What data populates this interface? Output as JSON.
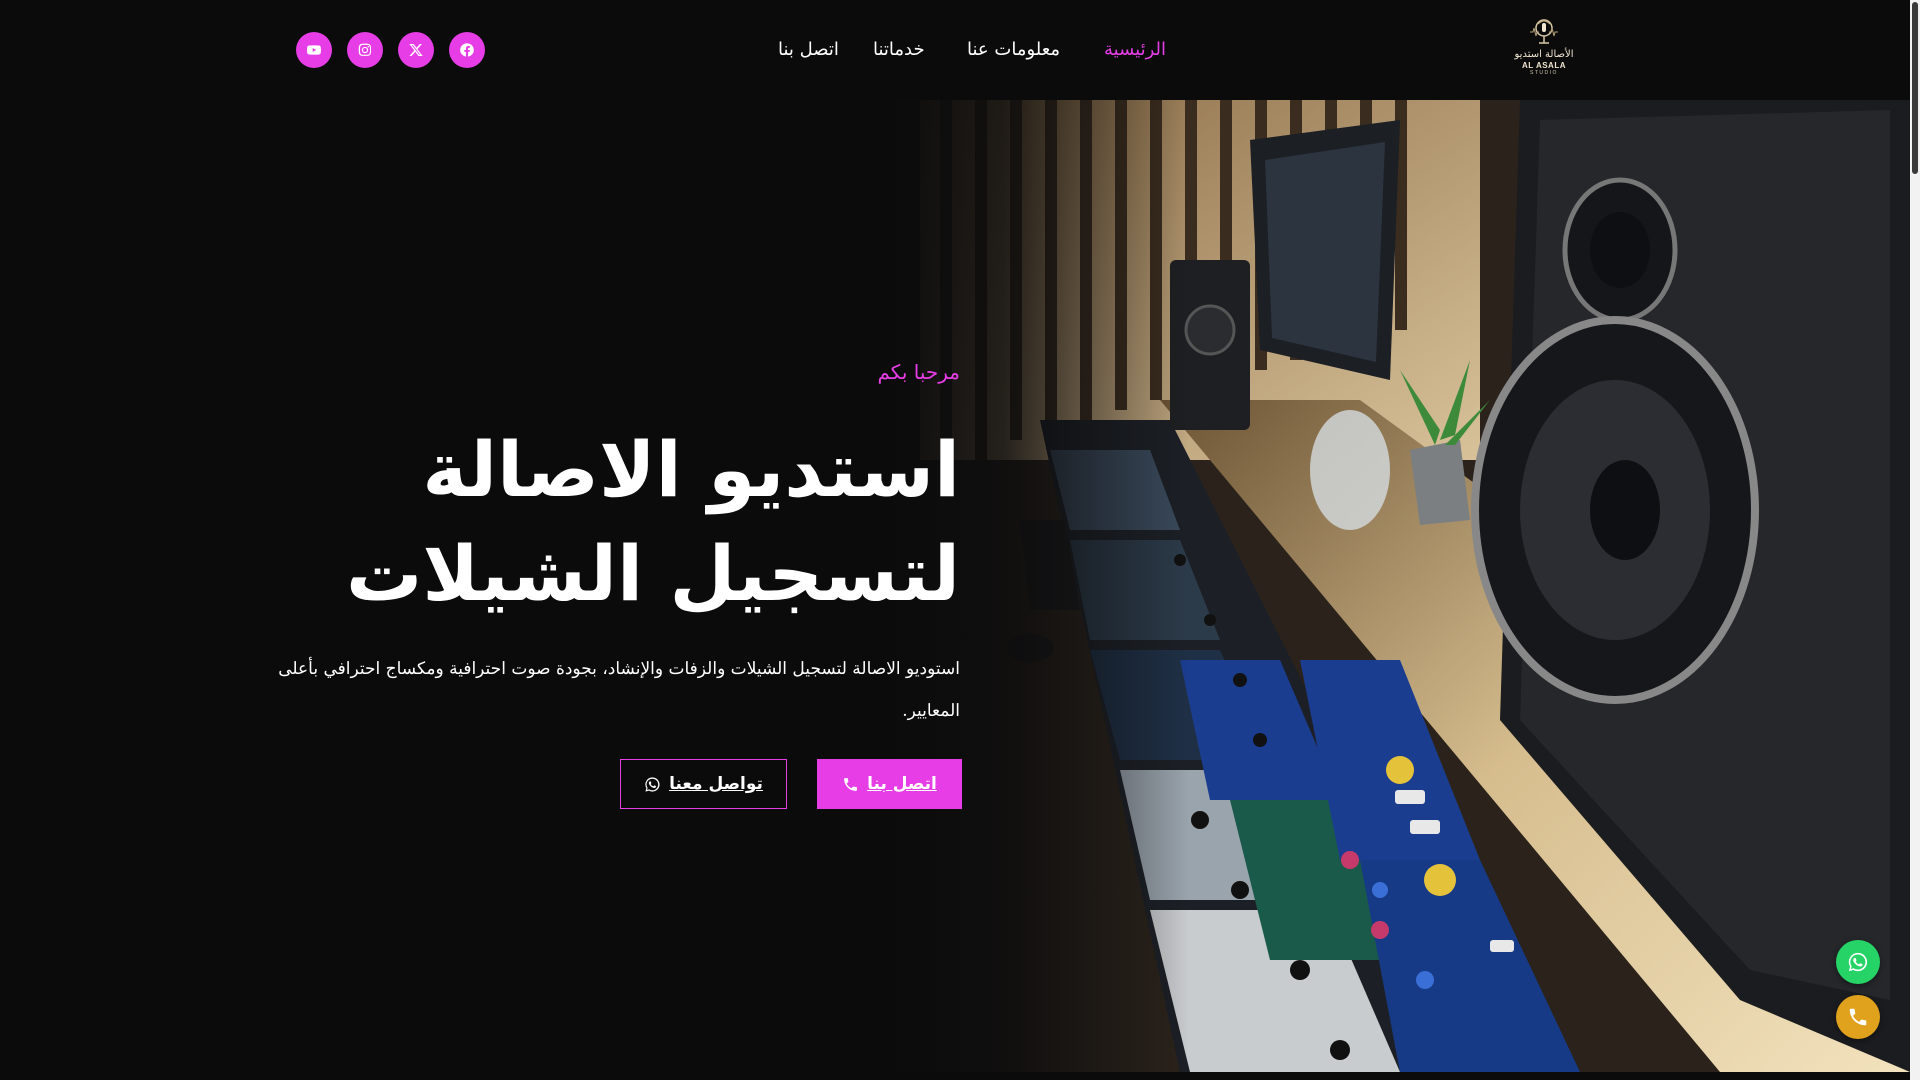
{
  "brand": {
    "logo_ar": "الأصالة استديو",
    "logo_en": "AL ASALA",
    "logo_sub": "STUDIO"
  },
  "nav": {
    "home": "الرئيسية",
    "about": "معلومات عنا",
    "services": "خدماتنا",
    "contact": "اتصل بنا"
  },
  "social": [
    "facebook-icon",
    "x-icon",
    "instagram-icon",
    "youtube-icon"
  ],
  "hero": {
    "greeting": "مرحبا بكم",
    "title_line1": "استديو الاصالة",
    "title_line2": "لتسجيل الشيلات",
    "description": "استوديو الاصالة لتسجيل الشيلات والزفات والإنشاد، بجودة صوت احترافية ومكساج احترافي بأعلى المعايير.",
    "call_button": "اتصل بنا",
    "whatsapp_button": "تواصل معنا"
  },
  "colors": {
    "accent": "#e73de6",
    "background": "#0b0b0c",
    "whatsapp": "#25d366",
    "phone": "#e0a21c"
  }
}
